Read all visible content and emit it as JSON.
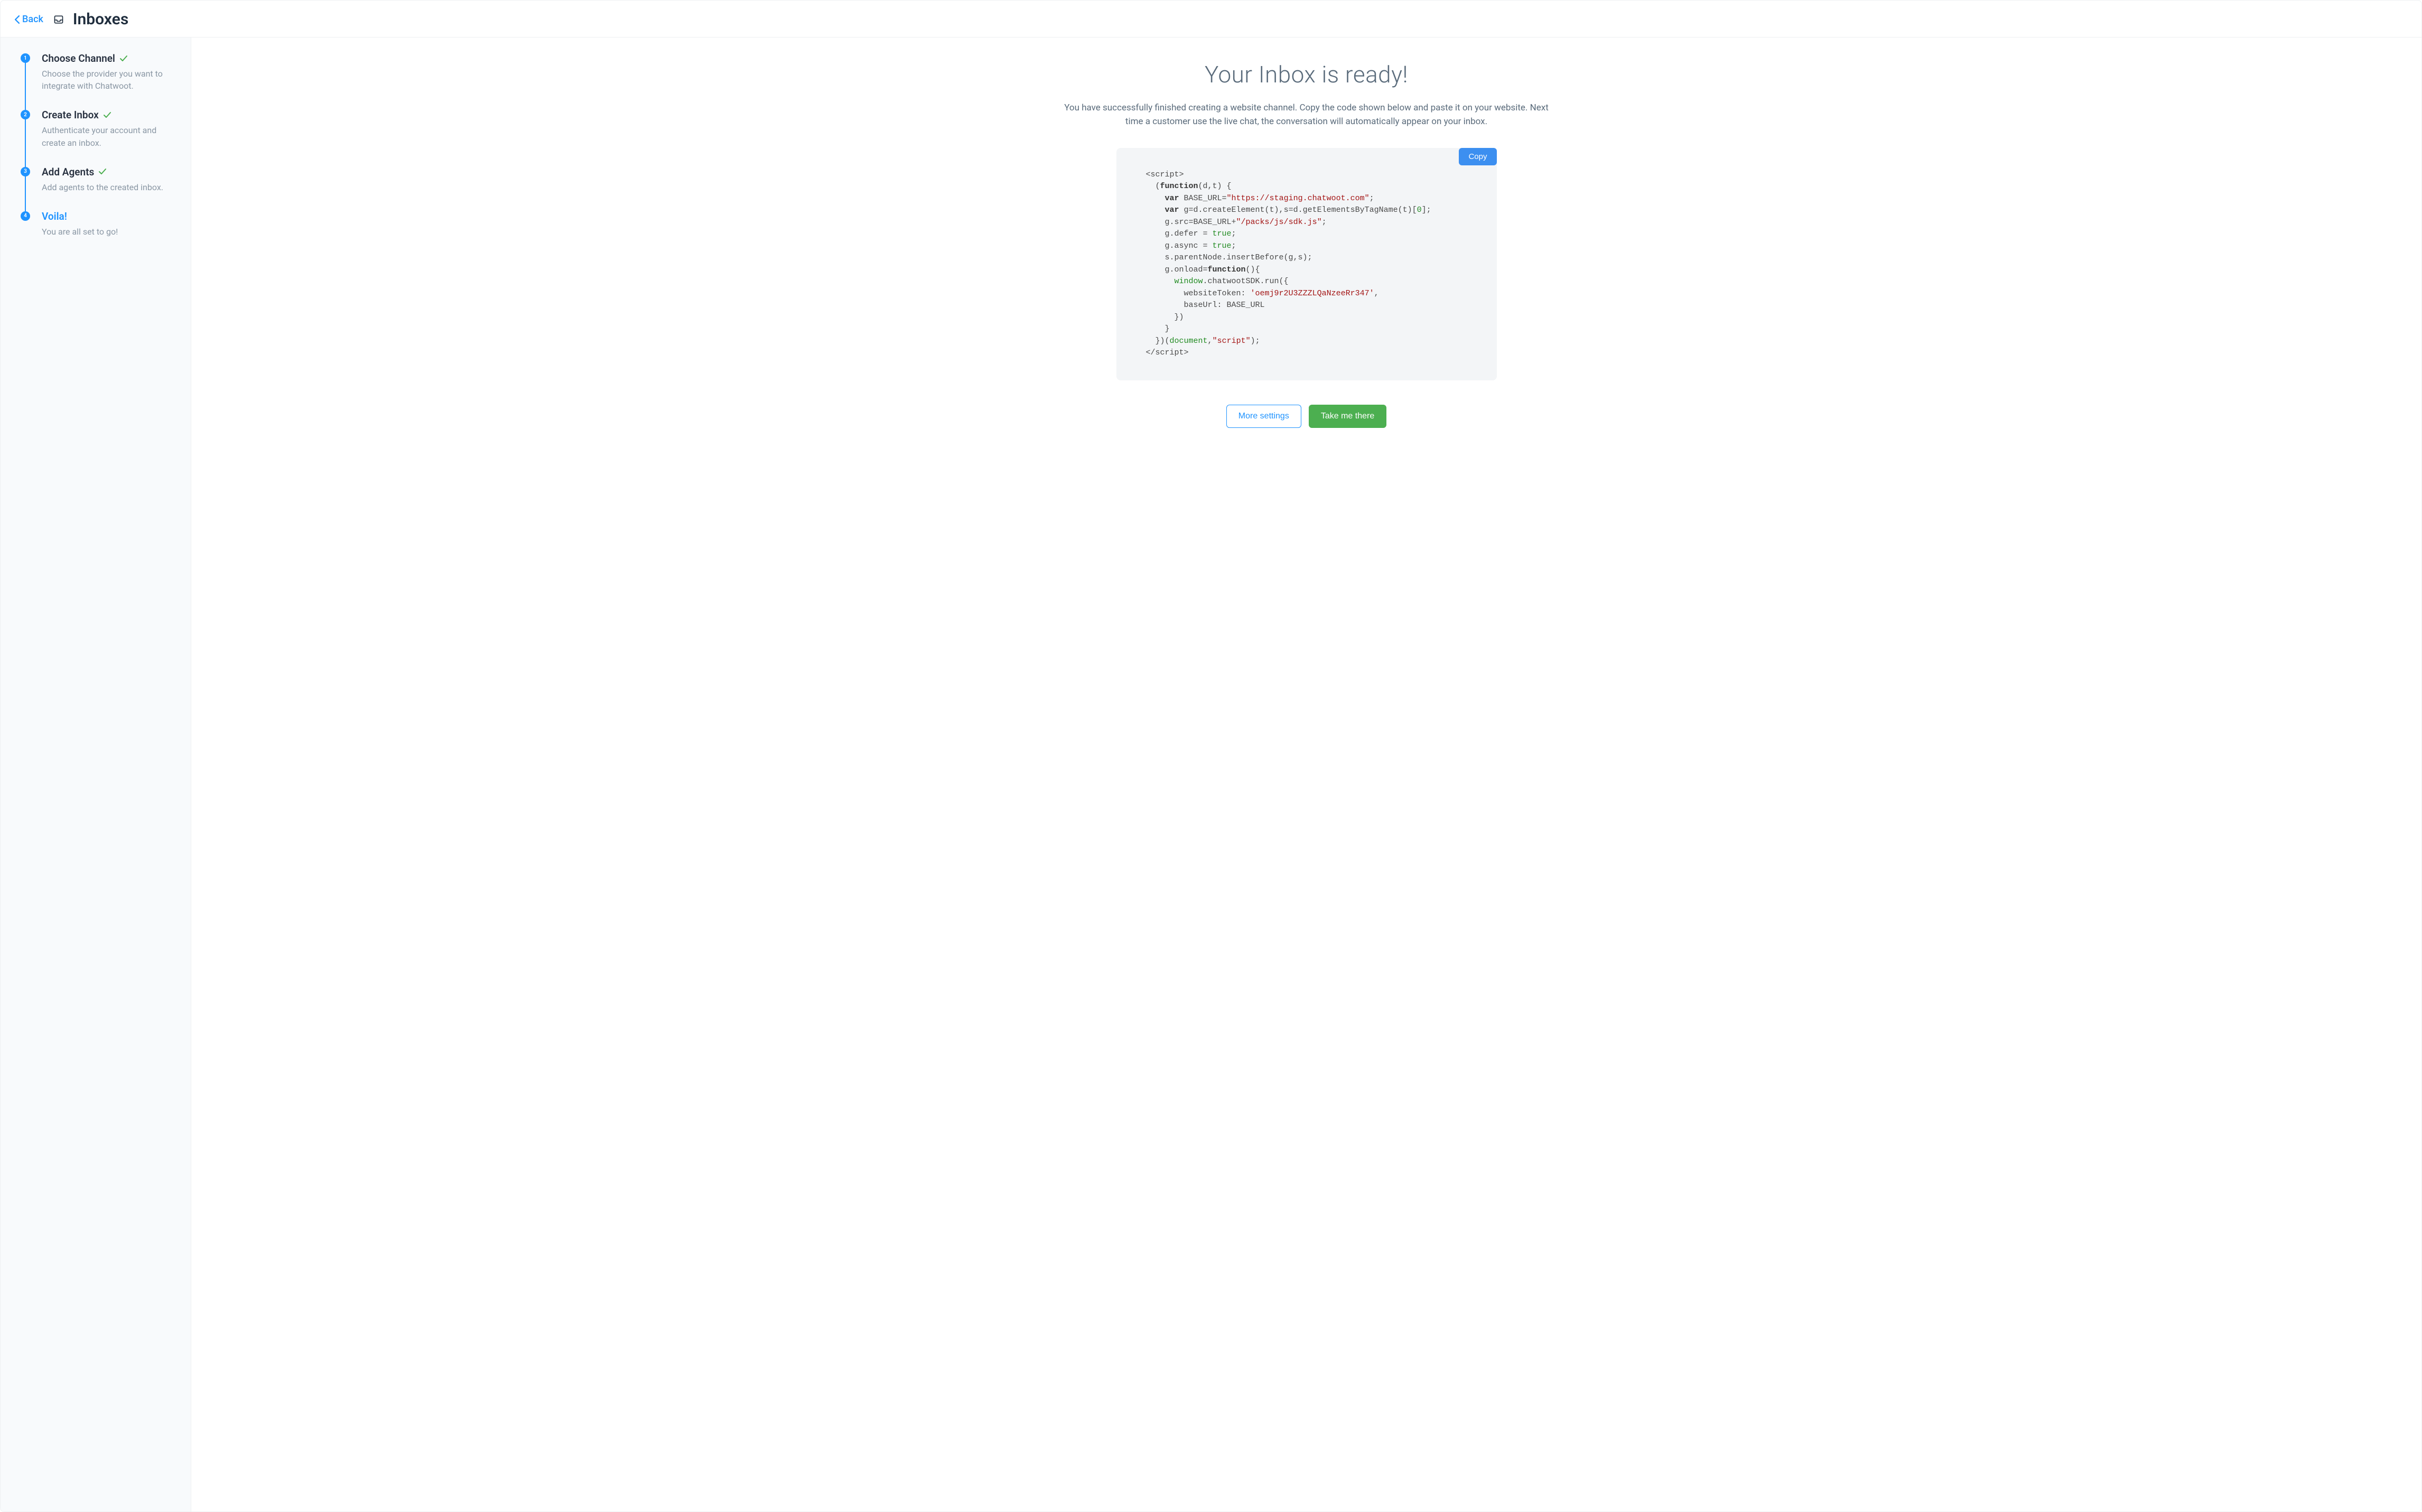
{
  "header": {
    "back_label": "Back",
    "title": "Inboxes"
  },
  "steps": [
    {
      "num": "1",
      "title": "Choose Channel",
      "desc": "Choose the provider you want to integrate with Chatwoot.",
      "done": true,
      "active": false
    },
    {
      "num": "2",
      "title": "Create Inbox",
      "desc": "Authenticate your account and create an inbox.",
      "done": true,
      "active": false
    },
    {
      "num": "3",
      "title": "Add Agents",
      "desc": "Add agents to the created inbox.",
      "done": true,
      "active": false
    },
    {
      "num": "4",
      "title": "Voila!",
      "desc": "You are all set to go!",
      "done": false,
      "active": true
    }
  ],
  "main": {
    "title": "Your Inbox is ready!",
    "description": "You have successfully finished creating a website channel. Copy the code shown below and paste it on your website. Next time a customer use the live chat, the conversation will automatically appear on your inbox.",
    "copy_label": "Copy",
    "more_settings_label": "More settings",
    "take_me_there_label": "Take me there",
    "snippet": {
      "base_url": "https://staging.chatwoot.com",
      "sdk_path": "/packs/js/sdk.js",
      "website_token": "oemj9r2U3ZZZLQaNzeeRr347"
    }
  }
}
